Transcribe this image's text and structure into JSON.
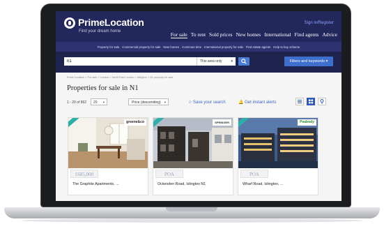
{
  "header": {
    "logo": "PrimeLocation",
    "tagline": "Find your dream home",
    "signin": "Sign in/Register",
    "nav": [
      "For sale",
      "To rent",
      "Sold prices",
      "New homes",
      "International",
      "Find agents",
      "Advice"
    ]
  },
  "subnav": [
    "Property for sale",
    "Commercial property for sale",
    "New homes",
    "Commute time",
    "International property for sale",
    "Find estate agents",
    "Help to buy scheme"
  ],
  "search": {
    "value": "n1",
    "area": "This area only",
    "filters": "Filters and keywords"
  },
  "breadcrumb": "Prime Location  >  For sale  >  London  >  North East London  >  Islington  >  N1 property for sale",
  "title": "Properties for sale in N1",
  "toolbar": {
    "count": "1 - 20 of 862",
    "per_page": "20",
    "sort": "Price (descending)",
    "save_search": "Save your search",
    "alerts": "Get instant alerts"
  },
  "listings": [
    {
      "price": "£685,000",
      "address": "The Graphite Apartments, ...",
      "badge": "greene&co"
    },
    {
      "price": "POA",
      "address": "Ockenden Road, Islington N1",
      "badge": "SPRINGER"
    },
    {
      "price": "POA",
      "address": "Wharf Road, Islington, ...",
      "badge": "Peabody"
    }
  ],
  "colors": {
    "header_bg": "#22275c",
    "accent": "#3e6fcc",
    "ribbon": "#2ab0a8"
  }
}
